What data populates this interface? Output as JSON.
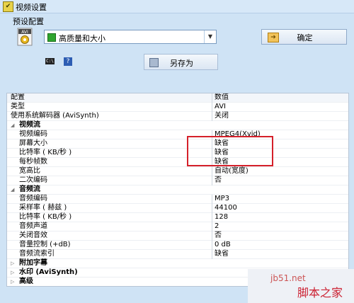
{
  "window": {
    "title": "视频设置"
  },
  "preset": {
    "label": "预设配置",
    "selected": "高质量和大小",
    "icon_name": "avi-file-icon",
    "icon_text": "AVI"
  },
  "buttons": {
    "ok": "确定",
    "save_as": "另存为"
  },
  "grid": {
    "col_name": "配置",
    "col_value": "数值",
    "rows": [
      {
        "type": "top",
        "name": "类型",
        "value": "AVI"
      },
      {
        "type": "top",
        "name": "使用系统解码器 (AviSynth)",
        "value": "关闭"
      },
      {
        "type": "cat",
        "name": "视频流",
        "expanded": true
      },
      {
        "type": "sub",
        "name": "视频编码",
        "value": "MPEG4(Xvid)"
      },
      {
        "type": "sub",
        "name": "屏幕大小",
        "value": "缺省"
      },
      {
        "type": "sub",
        "name": "比特率 ( KB/秒 )",
        "value": "缺省"
      },
      {
        "type": "sub",
        "name": "每秒帧数",
        "value": "缺省"
      },
      {
        "type": "sub",
        "name": "宽高比",
        "value": "自动(宽度)"
      },
      {
        "type": "sub",
        "name": "二次编码",
        "value": "否"
      },
      {
        "type": "cat",
        "name": "音频流",
        "expanded": true
      },
      {
        "type": "sub",
        "name": "音频编码",
        "value": "MP3"
      },
      {
        "type": "sub",
        "name": "采样率 ( 赫兹 )",
        "value": "44100"
      },
      {
        "type": "sub",
        "name": "比特率 ( KB/秒 )",
        "value": "128"
      },
      {
        "type": "sub",
        "name": "音频声道",
        "value": "2"
      },
      {
        "type": "sub",
        "name": "关闭音效",
        "value": "否"
      },
      {
        "type": "sub",
        "name": "音量控制 (+dB)",
        "value": "0 dB"
      },
      {
        "type": "sub",
        "name": "音频流索引",
        "value": "缺省"
      },
      {
        "type": "cat",
        "name": "附加字幕",
        "expanded": false
      },
      {
        "type": "cat",
        "name": "水印 (AviSynth)",
        "expanded": false
      },
      {
        "type": "cat",
        "name": "高级",
        "expanded": false
      }
    ]
  },
  "watermark": {
    "site": "jb51.net",
    "name": "脚本之家"
  },
  "colors": {
    "highlight": "#d5202a",
    "background": "#cfe3f5"
  }
}
